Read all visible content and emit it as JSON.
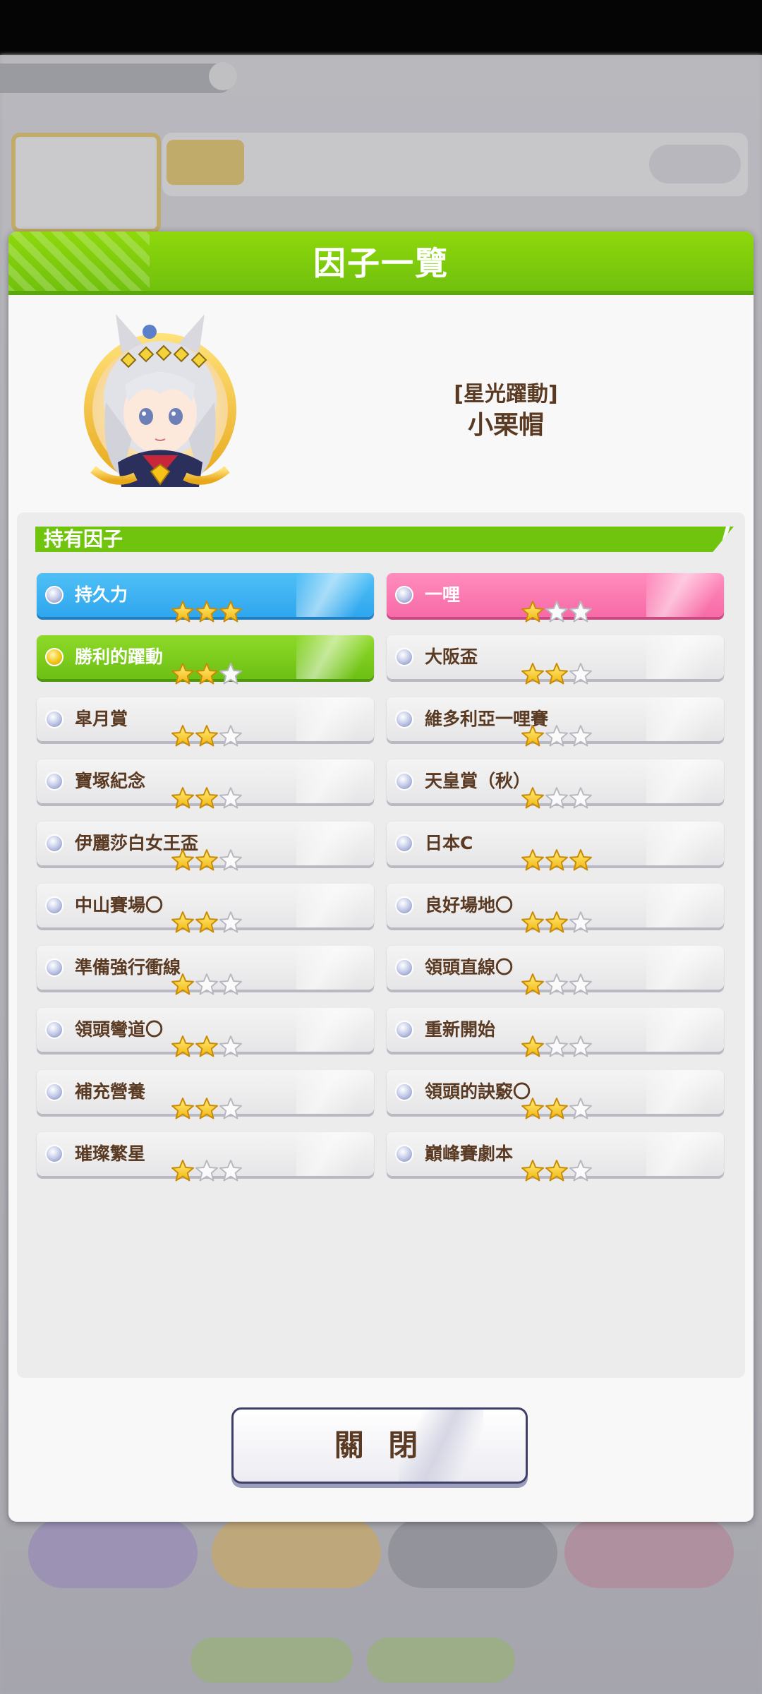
{
  "dialog": {
    "title": "因子一覽",
    "close_label": "關 閉"
  },
  "character": {
    "subtitle": "[星光躍動]",
    "name": "小栗帽"
  },
  "factors_section": {
    "title": "持有因子"
  },
  "colors": {
    "header_green": "#7cc90d",
    "stamina_blue": "#34aaf0",
    "distance_pink": "#f979b0",
    "unique_green": "#78c61a",
    "text_brown": "#5a3a22",
    "star_gold": "#f7c21a"
  },
  "factors": [
    {
      "label": "持久力",
      "stars": 3,
      "type": "blue"
    },
    {
      "label": "一哩",
      "stars": 1,
      "type": "pink"
    },
    {
      "label": "勝利的躍動",
      "stars": 2,
      "type": "green"
    },
    {
      "label": "大阪盃",
      "stars": 2,
      "type": "white"
    },
    {
      "label": "皐月賞",
      "stars": 2,
      "type": "white"
    },
    {
      "label": "維多利亞一哩賽",
      "stars": 1,
      "type": "white"
    },
    {
      "label": "寶塚紀念",
      "stars": 2,
      "type": "white"
    },
    {
      "label": "天皇賞（秋）",
      "stars": 1,
      "type": "white"
    },
    {
      "label": "伊麗莎白女王盃",
      "stars": 2,
      "type": "white"
    },
    {
      "label": "日本C",
      "stars": 3,
      "type": "white"
    },
    {
      "label": "中山賽場〇",
      "stars": 2,
      "type": "white"
    },
    {
      "label": "良好場地〇",
      "stars": 2,
      "type": "white"
    },
    {
      "label": "準備強行衝線",
      "stars": 1,
      "type": "white"
    },
    {
      "label": "領頭直線〇",
      "stars": 1,
      "type": "white"
    },
    {
      "label": "領頭彎道〇",
      "stars": 2,
      "type": "white"
    },
    {
      "label": "重新開始",
      "stars": 1,
      "type": "white"
    },
    {
      "label": "補充營養",
      "stars": 2,
      "type": "white"
    },
    {
      "label": "領頭的訣竅〇",
      "stars": 2,
      "type": "white"
    },
    {
      "label": "璀璨繁星",
      "stars": 1,
      "type": "white"
    },
    {
      "label": "巔峰賽劇本",
      "stars": 2,
      "type": "white"
    }
  ]
}
